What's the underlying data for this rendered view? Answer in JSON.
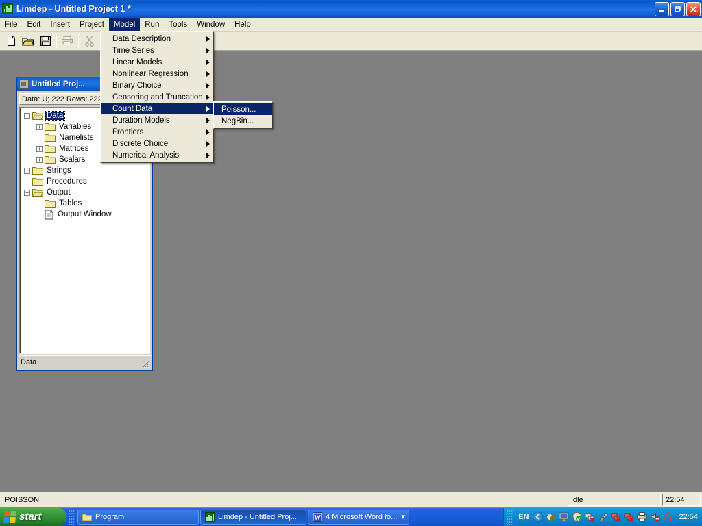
{
  "window": {
    "title": "Limdep - Untitled Project 1 *",
    "icon": "chart-icon",
    "controls": {
      "minimize": "minimize-button",
      "restore": "restore-button",
      "close": "close-button"
    }
  },
  "menubar": {
    "items": [
      {
        "label": "File",
        "open": false
      },
      {
        "label": "Edit",
        "open": false
      },
      {
        "label": "Insert",
        "open": false
      },
      {
        "label": "Project",
        "open": false
      },
      {
        "label": "Model",
        "open": true
      },
      {
        "label": "Run",
        "open": false
      },
      {
        "label": "Tools",
        "open": false
      },
      {
        "label": "Window",
        "open": false
      },
      {
        "label": "Help",
        "open": false
      }
    ]
  },
  "toolbar": {
    "buttons": [
      {
        "name": "new-icon",
        "enabled": true
      },
      {
        "name": "open-icon",
        "enabled": true
      },
      {
        "name": "save-icon",
        "enabled": true
      },
      {
        "name": "print-icon",
        "enabled": false
      },
      {
        "name": "cut-icon",
        "enabled": false
      },
      {
        "name": "copy-icon",
        "enabled": false
      },
      {
        "name": "paste-icon",
        "enabled": false
      },
      {
        "name": "table-icon",
        "enabled": true
      },
      {
        "name": "tools-icon",
        "enabled": true
      }
    ]
  },
  "model_menu": {
    "items": [
      {
        "label": "Data Description",
        "submenu": true,
        "selected": false
      },
      {
        "label": "Time Series",
        "submenu": true,
        "selected": false
      },
      {
        "label": "Linear Models",
        "submenu": true,
        "selected": false
      },
      {
        "label": "Nonlinear Regression",
        "submenu": true,
        "selected": false
      },
      {
        "label": "Binary Choice",
        "submenu": true,
        "selected": false
      },
      {
        "label": "Censoring and Truncation",
        "submenu": true,
        "selected": false
      },
      {
        "label": "Count Data",
        "submenu": true,
        "selected": true
      },
      {
        "label": "Duration Models",
        "submenu": true,
        "selected": false
      },
      {
        "label": "Frontiers",
        "submenu": true,
        "selected": false
      },
      {
        "label": "Discrete Choice",
        "submenu": true,
        "selected": false
      },
      {
        "label": "Numerical Analysis",
        "submenu": true,
        "selected": false
      }
    ]
  },
  "count_data_submenu": {
    "items": [
      {
        "label": "Poisson...",
        "selected": true
      },
      {
        "label": "NegBin...",
        "selected": false
      }
    ]
  },
  "project_window": {
    "title": "Untitled Proj...",
    "info": "Data: U; 222 Rows: 222",
    "status": "Data",
    "tree": [
      {
        "label": "Data",
        "indent": 0,
        "expander": "-",
        "icon": "open-folder",
        "selected": true
      },
      {
        "label": "Variables",
        "indent": 1,
        "expander": "+",
        "icon": "closed-folder",
        "selected": false
      },
      {
        "label": "Namelists",
        "indent": 1,
        "expander": "",
        "icon": "closed-folder",
        "selected": false
      },
      {
        "label": "Matrices",
        "indent": 1,
        "expander": "+",
        "icon": "closed-folder",
        "selected": false
      },
      {
        "label": "Scalars",
        "indent": 1,
        "expander": "+",
        "icon": "closed-folder",
        "selected": false
      },
      {
        "label": "Strings",
        "indent": 0,
        "expander": "+",
        "icon": "closed-folder",
        "selected": false
      },
      {
        "label": "Procedures",
        "indent": 0,
        "expander": "",
        "icon": "closed-folder",
        "selected": false
      },
      {
        "label": "Output",
        "indent": 0,
        "expander": "-",
        "icon": "open-folder",
        "selected": false
      },
      {
        "label": "Tables",
        "indent": 1,
        "expander": "",
        "icon": "closed-folder",
        "selected": false
      },
      {
        "label": "Output Window",
        "indent": 1,
        "expander": "",
        "icon": "document",
        "selected": false
      }
    ]
  },
  "statusbar": {
    "message": "POISSON",
    "state": "Idle",
    "time": "22:54"
  },
  "taskbar": {
    "start_label": "start",
    "tasks": [
      {
        "label": "Program",
        "icon": "folder-icon",
        "active": false
      },
      {
        "label": "Limdep - Untitled Proj...",
        "icon": "chart-icon",
        "active": true
      },
      {
        "label": "4 Microsoft Word fo...",
        "icon": "word-icon",
        "active": false,
        "group": true
      }
    ],
    "tray": {
      "language": "EN",
      "icons": [
        "show-hide-icon",
        "media-icon",
        "display-icon",
        "shield-check-icon",
        "network-error-icon",
        "plug-icon",
        "network-disconnected-icon",
        "network-disconnected-2-icon",
        "printer-icon",
        "volume-mute-icon",
        "droplet-icon"
      ],
      "clock": "22:54"
    }
  },
  "colors": {
    "menu_highlight": "#0a246a",
    "title_blue": "#1567dc",
    "face": "#ece9d8",
    "desktop": "#808080"
  }
}
